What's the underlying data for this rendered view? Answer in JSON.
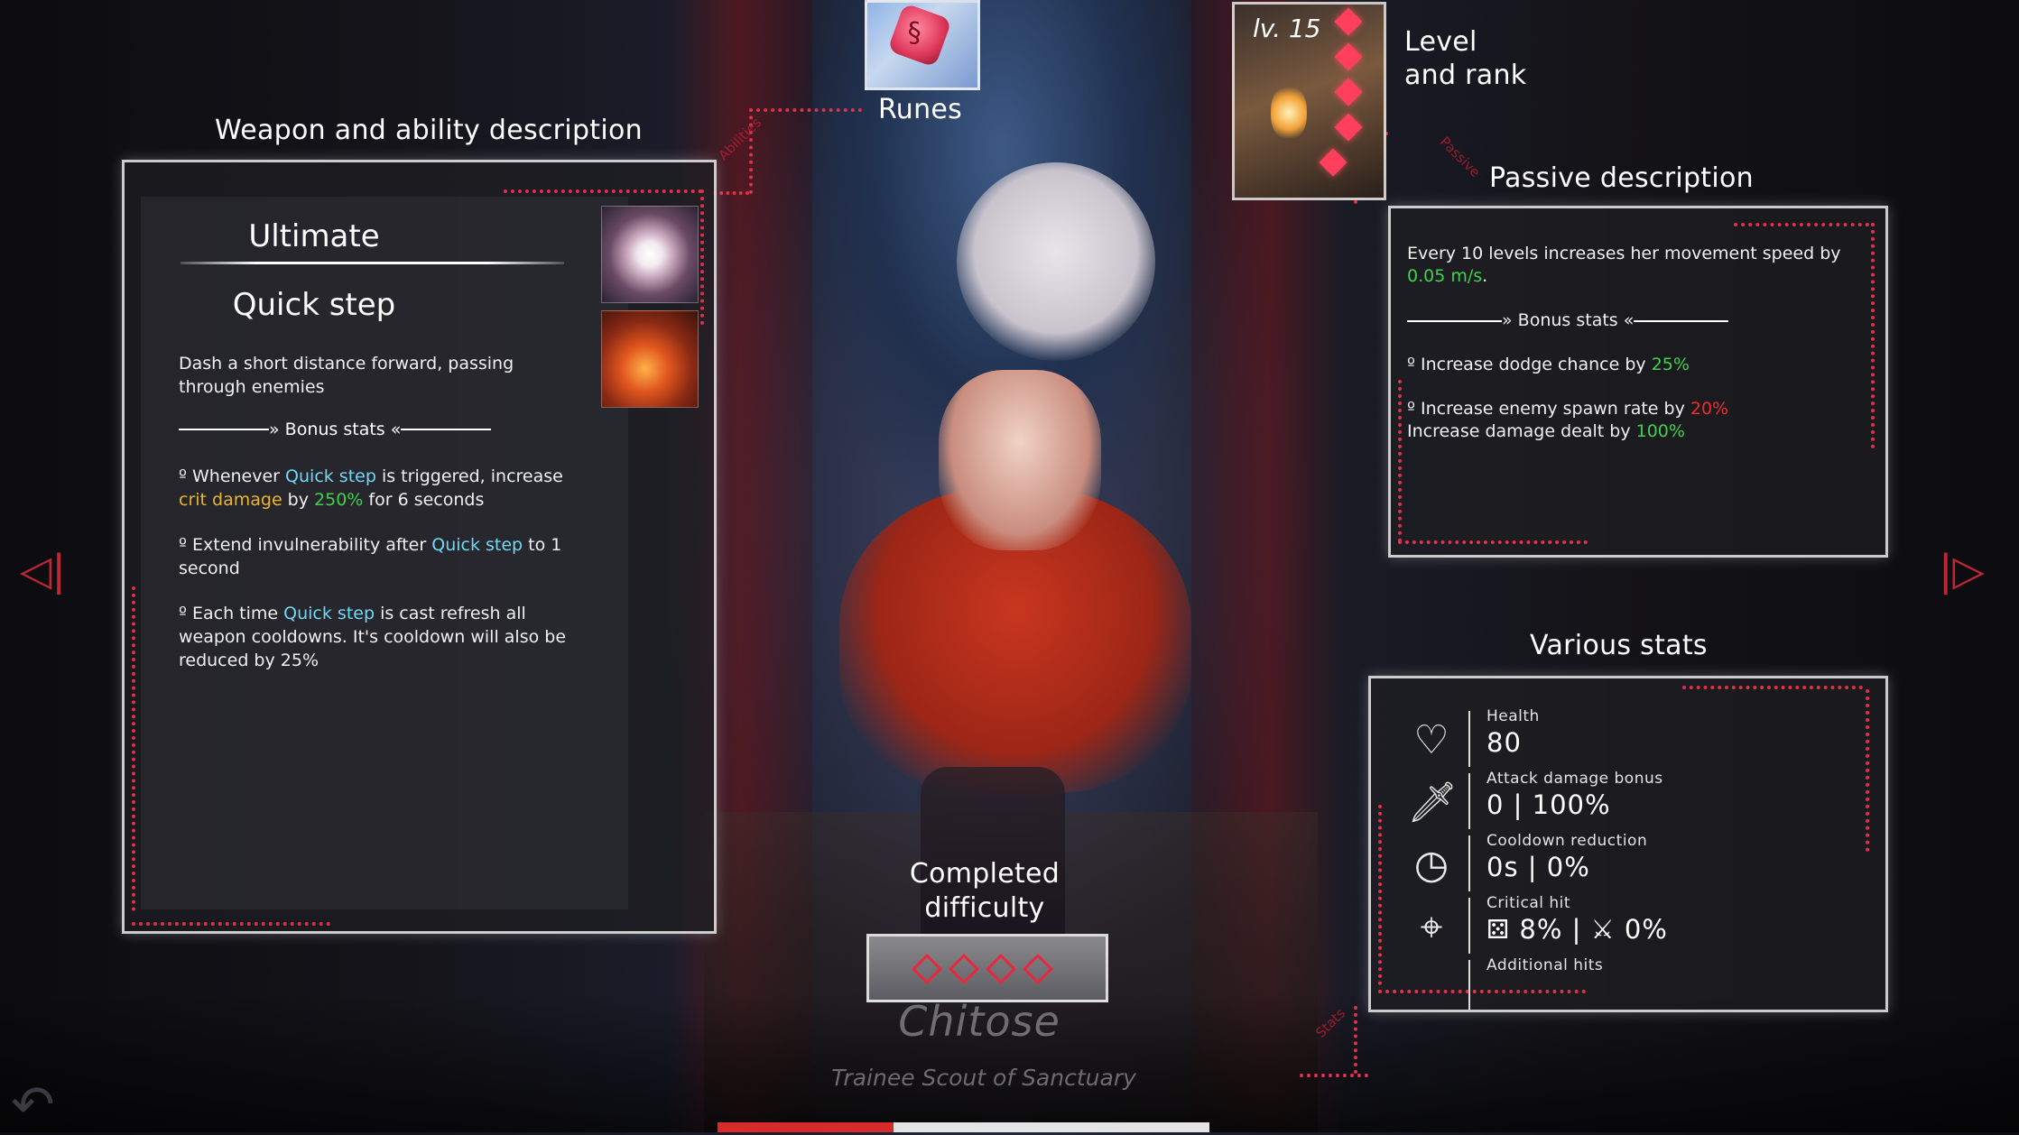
{
  "labels": {
    "weapon_section": "Weapon and ability description",
    "runes": "Runes",
    "level_rank_line1": "Level",
    "level_rank_line2": "and rank",
    "passive_section": "Passive description",
    "stats_section": "Various stats",
    "difficulty_line1": "Completed",
    "difficulty_line2": "difficulty"
  },
  "connector_tags": {
    "abilities": "Abilities",
    "passive": "Passive",
    "stats": "Stats"
  },
  "weapon": {
    "category": "Ultimate",
    "ability_name": "Quick step",
    "description": "Dash a short distance forward, passing through enemies",
    "bonus_header": "Bonus stats",
    "bonus": [
      {
        "parts": [
          {
            "t": "Whenever ",
            "c": ""
          },
          {
            "t": "Quick step",
            "c": "blue"
          },
          {
            "t": " is triggered, increase ",
            "c": ""
          },
          {
            "t": "crit damage",
            "c": "gold"
          },
          {
            "t": " by ",
            "c": ""
          },
          {
            "t": "250%",
            "c": "green"
          },
          {
            "t": " for 6 seconds",
            "c": ""
          }
        ]
      },
      {
        "parts": [
          {
            "t": "Extend invulnerability after ",
            "c": ""
          },
          {
            "t": "Quick step",
            "c": "blue"
          },
          {
            "t": " to 1 second",
            "c": ""
          }
        ]
      },
      {
        "parts": [
          {
            "t": "Each time ",
            "c": ""
          },
          {
            "t": "Quick step",
            "c": "blue"
          },
          {
            "t": " is cast refresh all weapon cooldowns. It's cooldown will also be reduced by 25%",
            "c": ""
          }
        ]
      }
    ]
  },
  "level": {
    "text": "lv. 15",
    "rank_stars": 5
  },
  "passive": {
    "intro": [
      {
        "t": "Every 10 levels increases her movement speed by ",
        "c": ""
      },
      {
        "t": "0.05 m/s",
        "c": "green"
      },
      {
        "t": ".",
        "c": ""
      }
    ],
    "bonus_header": "Bonus stats",
    "bonus": [
      {
        "parts": [
          {
            "t": "Increase dodge chance by ",
            "c": ""
          },
          {
            "t": "25%",
            "c": "green"
          }
        ]
      },
      {
        "parts": [
          {
            "t": "Increase enemy spawn rate by ",
            "c": ""
          },
          {
            "t": "20%",
            "c": "red"
          },
          {
            "t": "\nIncrease damage dealt by ",
            "c": ""
          },
          {
            "t": "100%",
            "c": "green"
          }
        ]
      }
    ]
  },
  "stats": [
    {
      "icon": "heart-icon",
      "glyph": "♡",
      "label": "Health",
      "value": "80"
    },
    {
      "icon": "sword-icon",
      "glyph": "🗡",
      "label": "Attack damage bonus",
      "value": "0 | 100%"
    },
    {
      "icon": "clock-icon",
      "glyph": "◷",
      "label": "Cooldown reduction",
      "value": "0s | 0%"
    },
    {
      "icon": "crosshair-icon",
      "glyph": "⌖",
      "label": "Critical hit",
      "value": "⚄ 8% | ⚔ 0%"
    },
    {
      "icon": "arrow-icon",
      "glyph": "",
      "label": "Additional hits",
      "value": ""
    }
  ],
  "difficulty": {
    "diamonds": 4,
    "color": "#e8283f"
  },
  "character": {
    "name": "Chitose",
    "title": "Trainee Scout of Sanctuary"
  },
  "colors": {
    "accent_red": "#e2304a",
    "highlight_blue": "#6fd9f5",
    "highlight_green": "#3ed14c",
    "highlight_gold": "#e8b52c",
    "highlight_red": "#ef2c2c"
  }
}
